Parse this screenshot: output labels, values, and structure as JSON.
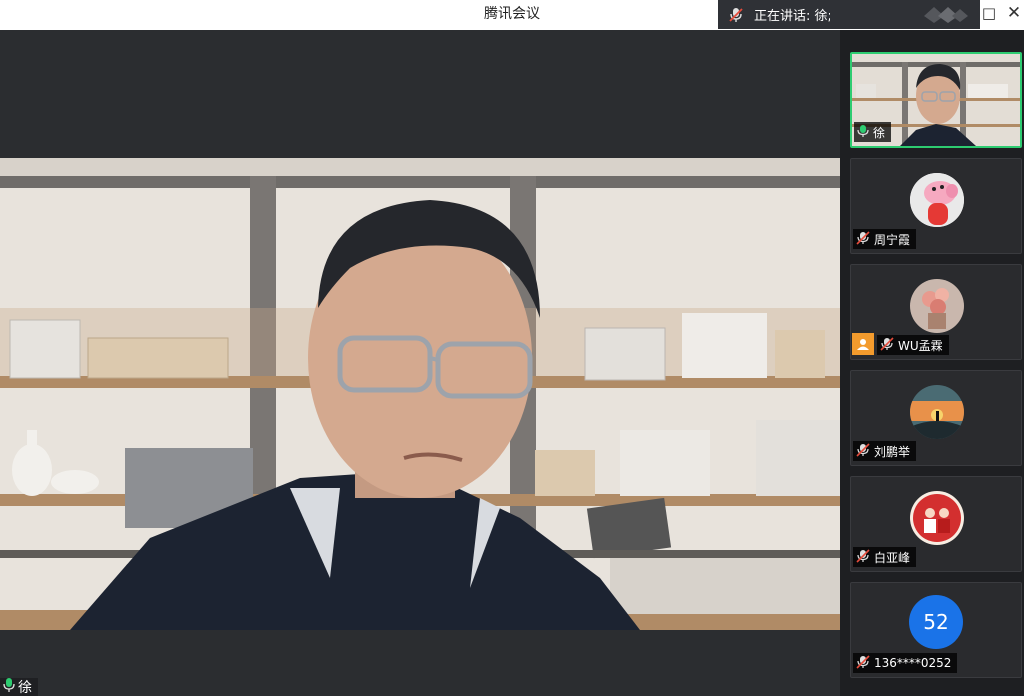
{
  "window": {
    "title": "腾讯会议",
    "maximize_glyph": "□",
    "close_glyph": "✕"
  },
  "speaking": {
    "label": "正在讲话: 徐;"
  },
  "main_video": {
    "name": "徐"
  },
  "participants": [
    {
      "name": "徐",
      "mic": "on",
      "avatar": "camera"
    },
    {
      "name": "周宁霞",
      "mic": "muted",
      "avatar": "pig-cartoon"
    },
    {
      "name": "WU孟霖",
      "mic": "muted",
      "avatar": "flowers",
      "host": true
    },
    {
      "name": "刘鹏举",
      "mic": "muted",
      "avatar": "sunset"
    },
    {
      "name": "白亚峰",
      "mic": "muted",
      "avatar": "couple-red"
    },
    {
      "name": "136****0252",
      "mic": "muted",
      "avatar": "number",
      "avatar_text": "52"
    }
  ],
  "colors": {
    "active_border": "#2ecc71",
    "host_badge": "#f39b2d",
    "number_avatar": "#1a73e8",
    "mic_on": "#2ecc71",
    "mic_muted": "#e74c3c"
  }
}
